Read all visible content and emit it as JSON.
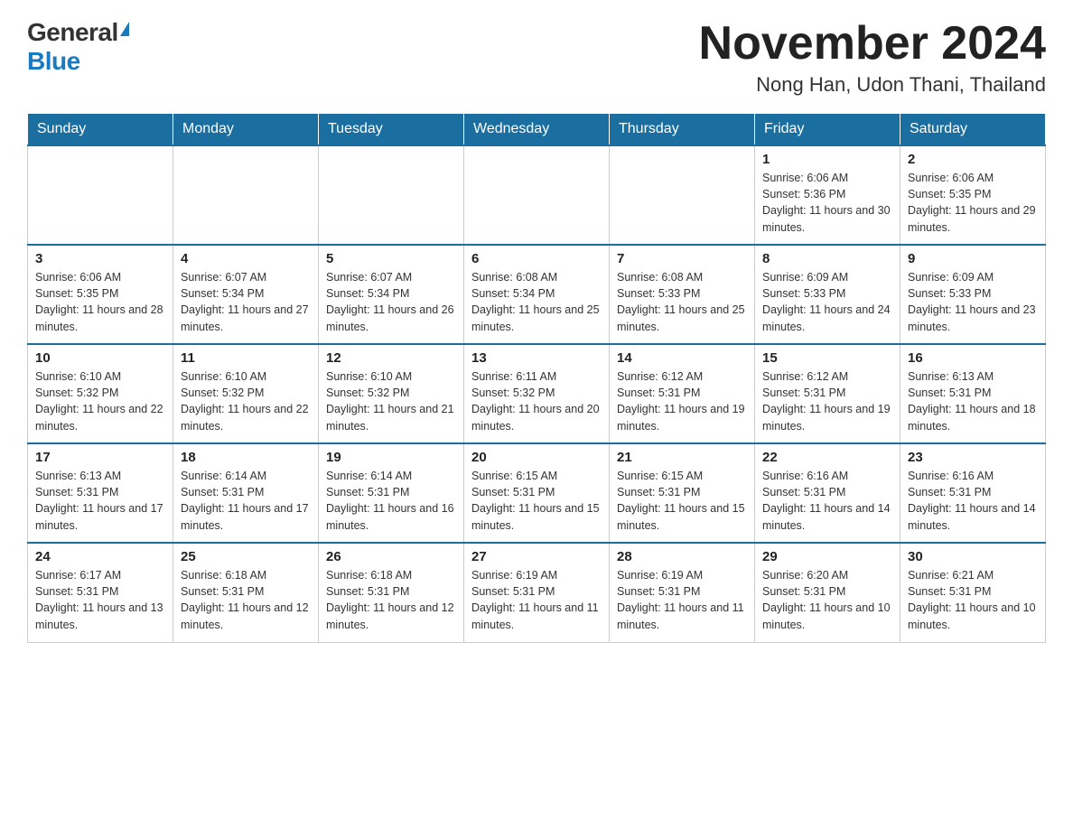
{
  "header": {
    "logo_general": "General",
    "logo_blue": "Blue",
    "month_title": "November 2024",
    "location": "Nong Han, Udon Thani, Thailand"
  },
  "weekdays": [
    "Sunday",
    "Monday",
    "Tuesday",
    "Wednesday",
    "Thursday",
    "Friday",
    "Saturday"
  ],
  "weeks": [
    [
      {
        "day": "",
        "info": ""
      },
      {
        "day": "",
        "info": ""
      },
      {
        "day": "",
        "info": ""
      },
      {
        "day": "",
        "info": ""
      },
      {
        "day": "",
        "info": ""
      },
      {
        "day": "1",
        "info": "Sunrise: 6:06 AM\nSunset: 5:36 PM\nDaylight: 11 hours and 30 minutes."
      },
      {
        "day": "2",
        "info": "Sunrise: 6:06 AM\nSunset: 5:35 PM\nDaylight: 11 hours and 29 minutes."
      }
    ],
    [
      {
        "day": "3",
        "info": "Sunrise: 6:06 AM\nSunset: 5:35 PM\nDaylight: 11 hours and 28 minutes."
      },
      {
        "day": "4",
        "info": "Sunrise: 6:07 AM\nSunset: 5:34 PM\nDaylight: 11 hours and 27 minutes."
      },
      {
        "day": "5",
        "info": "Sunrise: 6:07 AM\nSunset: 5:34 PM\nDaylight: 11 hours and 26 minutes."
      },
      {
        "day": "6",
        "info": "Sunrise: 6:08 AM\nSunset: 5:34 PM\nDaylight: 11 hours and 25 minutes."
      },
      {
        "day": "7",
        "info": "Sunrise: 6:08 AM\nSunset: 5:33 PM\nDaylight: 11 hours and 25 minutes."
      },
      {
        "day": "8",
        "info": "Sunrise: 6:09 AM\nSunset: 5:33 PM\nDaylight: 11 hours and 24 minutes."
      },
      {
        "day": "9",
        "info": "Sunrise: 6:09 AM\nSunset: 5:33 PM\nDaylight: 11 hours and 23 minutes."
      }
    ],
    [
      {
        "day": "10",
        "info": "Sunrise: 6:10 AM\nSunset: 5:32 PM\nDaylight: 11 hours and 22 minutes."
      },
      {
        "day": "11",
        "info": "Sunrise: 6:10 AM\nSunset: 5:32 PM\nDaylight: 11 hours and 22 minutes."
      },
      {
        "day": "12",
        "info": "Sunrise: 6:10 AM\nSunset: 5:32 PM\nDaylight: 11 hours and 21 minutes."
      },
      {
        "day": "13",
        "info": "Sunrise: 6:11 AM\nSunset: 5:32 PM\nDaylight: 11 hours and 20 minutes."
      },
      {
        "day": "14",
        "info": "Sunrise: 6:12 AM\nSunset: 5:31 PM\nDaylight: 11 hours and 19 minutes."
      },
      {
        "day": "15",
        "info": "Sunrise: 6:12 AM\nSunset: 5:31 PM\nDaylight: 11 hours and 19 minutes."
      },
      {
        "day": "16",
        "info": "Sunrise: 6:13 AM\nSunset: 5:31 PM\nDaylight: 11 hours and 18 minutes."
      }
    ],
    [
      {
        "day": "17",
        "info": "Sunrise: 6:13 AM\nSunset: 5:31 PM\nDaylight: 11 hours and 17 minutes."
      },
      {
        "day": "18",
        "info": "Sunrise: 6:14 AM\nSunset: 5:31 PM\nDaylight: 11 hours and 17 minutes."
      },
      {
        "day": "19",
        "info": "Sunrise: 6:14 AM\nSunset: 5:31 PM\nDaylight: 11 hours and 16 minutes."
      },
      {
        "day": "20",
        "info": "Sunrise: 6:15 AM\nSunset: 5:31 PM\nDaylight: 11 hours and 15 minutes."
      },
      {
        "day": "21",
        "info": "Sunrise: 6:15 AM\nSunset: 5:31 PM\nDaylight: 11 hours and 15 minutes."
      },
      {
        "day": "22",
        "info": "Sunrise: 6:16 AM\nSunset: 5:31 PM\nDaylight: 11 hours and 14 minutes."
      },
      {
        "day": "23",
        "info": "Sunrise: 6:16 AM\nSunset: 5:31 PM\nDaylight: 11 hours and 14 minutes."
      }
    ],
    [
      {
        "day": "24",
        "info": "Sunrise: 6:17 AM\nSunset: 5:31 PM\nDaylight: 11 hours and 13 minutes."
      },
      {
        "day": "25",
        "info": "Sunrise: 6:18 AM\nSunset: 5:31 PM\nDaylight: 11 hours and 12 minutes."
      },
      {
        "day": "26",
        "info": "Sunrise: 6:18 AM\nSunset: 5:31 PM\nDaylight: 11 hours and 12 minutes."
      },
      {
        "day": "27",
        "info": "Sunrise: 6:19 AM\nSunset: 5:31 PM\nDaylight: 11 hours and 11 minutes."
      },
      {
        "day": "28",
        "info": "Sunrise: 6:19 AM\nSunset: 5:31 PM\nDaylight: 11 hours and 11 minutes."
      },
      {
        "day": "29",
        "info": "Sunrise: 6:20 AM\nSunset: 5:31 PM\nDaylight: 11 hours and 10 minutes."
      },
      {
        "day": "30",
        "info": "Sunrise: 6:21 AM\nSunset: 5:31 PM\nDaylight: 11 hours and 10 minutes."
      }
    ]
  ]
}
